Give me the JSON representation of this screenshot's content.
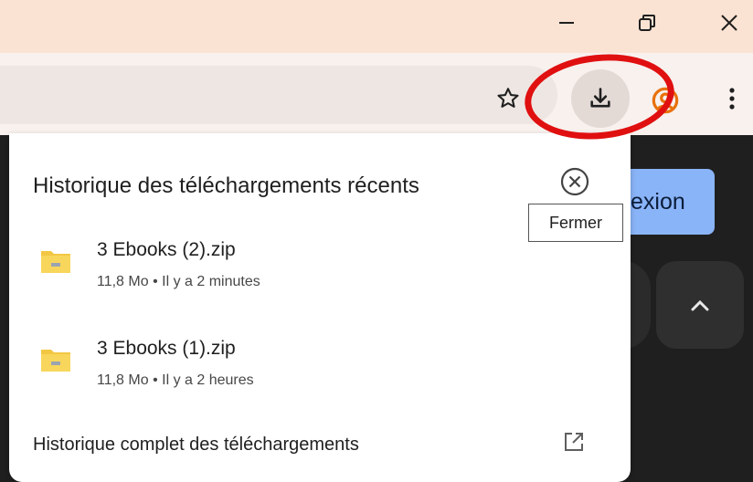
{
  "window": {
    "minimize_icon": "minimize-icon",
    "maximize_icon": "restore-icon",
    "close_icon": "close-icon"
  },
  "toolbar": {
    "bookmark_icon": "star-icon",
    "download_icon": "download-icon",
    "profile_icon": "profile-icon",
    "menu_icon": "more-vert-icon"
  },
  "page": {
    "button_partial_label": "exion"
  },
  "downloads": {
    "title": "Historique des téléchargements récents",
    "close_tooltip": "Fermer",
    "items": [
      {
        "name": "3 Ebooks (2).zip",
        "meta": "11,8 Mo • Il y a 2 minutes",
        "icon": "zip-folder-icon"
      },
      {
        "name": "3 Ebooks (1).zip",
        "meta": "11,8 Mo • Il y a 2 heures",
        "icon": "zip-folder-icon"
      }
    ],
    "full_history_link": "Historique complet des téléchargements"
  },
  "colors": {
    "titlebar": "#fbe3d3",
    "toolbar": "#f8f1ee",
    "highlight_ring": "#e01010",
    "profile_accent": "#e8710a"
  }
}
